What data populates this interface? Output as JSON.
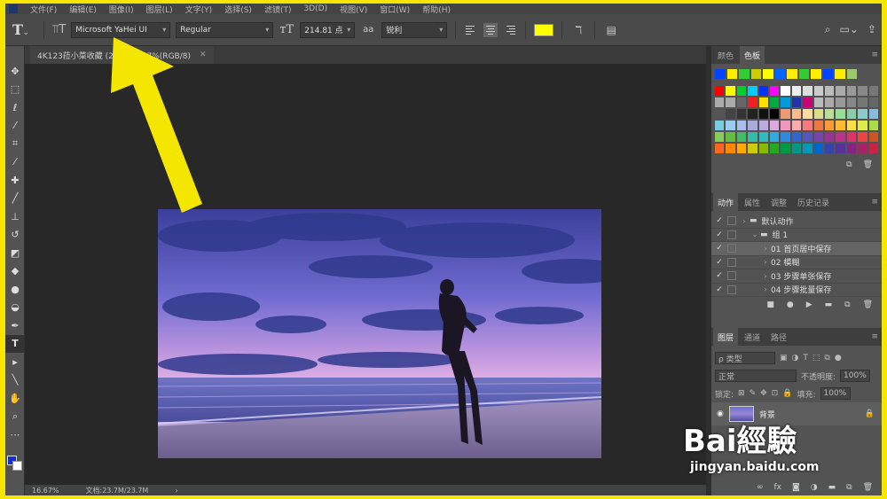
{
  "menu": {
    "items": [
      "文件(F)",
      "编辑(E)",
      "图像(I)",
      "图层(L)",
      "文字(Y)",
      "选择(S)",
      "滤镜(T)",
      "3D(D)",
      "视图(V)",
      "窗口(W)",
      "帮助(H)"
    ]
  },
  "options": {
    "font_family": "Microsoft YaHei UI",
    "font_style": "Regular",
    "font_size": "214.81 点",
    "aa_icon": "aa",
    "antialias": "锐利",
    "text_color": "#ffff00"
  },
  "document": {
    "tab_title": "4K123菈小菜收藏 (2... @ 16.7%(RGB/8)",
    "zoom": "16.67%",
    "doc_info": "文档:23.7M/23.7M"
  },
  "swatches_panel": {
    "tabs": [
      "颜色",
      "色板"
    ],
    "active_tab": "色板",
    "recent": [
      "#0044ff",
      "#ffee00",
      "#33cc33",
      "#cccc00",
      "#ffff00",
      "#0066ff",
      "#ffee00",
      "#33cc33",
      "#ffee00",
      "#0044ff",
      "#ffee00",
      "#99cc66"
    ],
    "rows": [
      [
        "#ff0000",
        "#ffff00",
        "#00cc33",
        "#00ccff",
        "#0033ff",
        "#ff00ff",
        "#ffffff",
        "#eeeeee",
        "#dddddd",
        "#cccccc",
        "#bbbbbb",
        "#aaaaaa",
        "#999999",
        "#888888",
        "#777777"
      ],
      [
        "#aaaaaa",
        "#aaaaaa",
        "#666666",
        "#ee2222",
        "#ffdd00",
        "#00aa44",
        "#0099dd",
        "#2233aa",
        "#cc0077",
        "#bbbbbb",
        "#aaaaaa",
        "#999999",
        "#888888",
        "#777777",
        "#666666"
      ],
      [
        "#555555",
        "#444444",
        "#333333",
        "#222222",
        "#111111",
        "#000000",
        "#ee9977",
        "#ffbb88",
        "#ffdd99",
        "#dddd88",
        "#bbdd99",
        "#99dd99",
        "#88ccaa",
        "#88cccc",
        "#88bbdd"
      ],
      [
        "#77ccdd",
        "#99ccee",
        "#aabbee",
        "#aaaadd",
        "#bbaadd",
        "#ddaadd",
        "#ee99bb",
        "#ffaaaa",
        "#ff7777",
        "#ee7744",
        "#ff9933",
        "#ffbb33",
        "#ffdd44",
        "#ddee44",
        "#aadd44"
      ],
      [
        "#88cc55",
        "#66bb44",
        "#44bb66",
        "#33bbaa",
        "#33bbbb",
        "#33aadd",
        "#3388dd",
        "#3366cc",
        "#5555bb",
        "#7744aa",
        "#993399",
        "#bb3388",
        "#dd3366",
        "#ee4444",
        "#cc5522"
      ],
      [
        "#ff6622",
        "#ff8800",
        "#ffaa00",
        "#cccc00",
        "#88bb00",
        "#22aa22",
        "#009944",
        "#009988",
        "#0099bb",
        "#0066cc",
        "#3344aa",
        "#553399",
        "#882288",
        "#aa2266",
        "#cc2244"
      ]
    ]
  },
  "actions_panel": {
    "tabs": [
      "动作",
      "属性",
      "调整",
      "历史记录"
    ],
    "active_tab": "动作",
    "rows": [
      {
        "label": "默认动作",
        "indent": 0,
        "folder": true,
        "selected": false
      },
      {
        "label": "组 1",
        "indent": 1,
        "folder": true,
        "selected": false
      },
      {
        "label": "01 首页居中保存",
        "indent": 2,
        "folder": false,
        "selected": true
      },
      {
        "label": "02 模糊",
        "indent": 2,
        "folder": false,
        "selected": false
      },
      {
        "label": "03 步骤单张保存",
        "indent": 2,
        "folder": false,
        "selected": false
      },
      {
        "label": "04 步骤批量保存",
        "indent": 2,
        "folder": false,
        "selected": false
      }
    ]
  },
  "layers_panel": {
    "tabs": [
      "图层",
      "通道",
      "路径"
    ],
    "active_tab": "图层",
    "filter_label": "ρ 类型",
    "blend_mode": "正常",
    "opacity_label": "不透明度:",
    "opacity_value": "100%",
    "lock_label": "锁定:",
    "fill_label": "填充:",
    "fill_value": "100%",
    "layers": [
      {
        "name": "背景"
      }
    ]
  },
  "watermark": {
    "logo": "Bai經驗",
    "url": "jingyan.baidu.com"
  },
  "highlight_color": "#f5e600"
}
